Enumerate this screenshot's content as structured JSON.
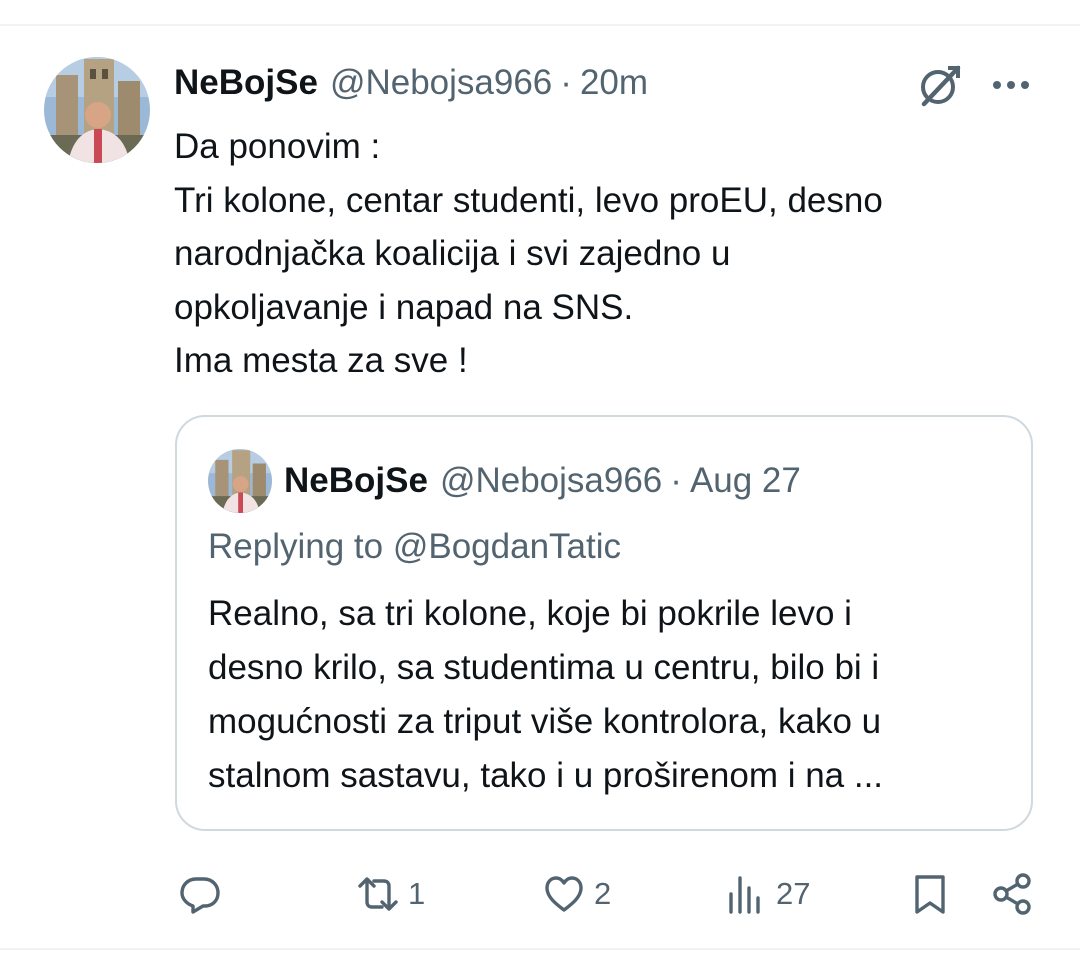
{
  "tweet": {
    "display_name": "NeBojSe",
    "handle": "@Nebojsa966",
    "separator": "·",
    "time": "20m",
    "text_lines": [
      "Da ponovim :",
      "Tri kolone, centar studenti, levo proEU, desno",
      "narodnjačka koalicija i svi zajedno u",
      "opkoljavanje i napad na SNS.",
      "Ima mesta za sve !"
    ]
  },
  "quoted": {
    "display_name": "NeBojSe",
    "handle": "@Nebojsa966",
    "separator": "·",
    "date": "Aug 27",
    "replying_prefix": "Replying to",
    "replying_to": "@BogdanTatic",
    "text_lines": [
      "Realno, sa tri kolone, koje bi pokrile levo i",
      "desno krilo, sa studentima u centru, bilo bi i",
      "mogućnosti za triput više kontrolora, kako u",
      "stalnom sastavu, tako i u proširenom i na ..."
    ]
  },
  "actions": {
    "reply_count": "",
    "retweet_count": "1",
    "like_count": "2",
    "views_count": "27"
  },
  "icons": {
    "grok": "grok-icon",
    "more": "more-horizontal-icon",
    "reply": "reply-icon",
    "retweet": "retweet-icon",
    "like": "heart-icon",
    "views": "views-chart-icon",
    "bookmark": "bookmark-icon",
    "share": "share-icon"
  },
  "colors": {
    "text": "#0f1419",
    "secondary": "#536471",
    "border": "#cfd9de"
  }
}
